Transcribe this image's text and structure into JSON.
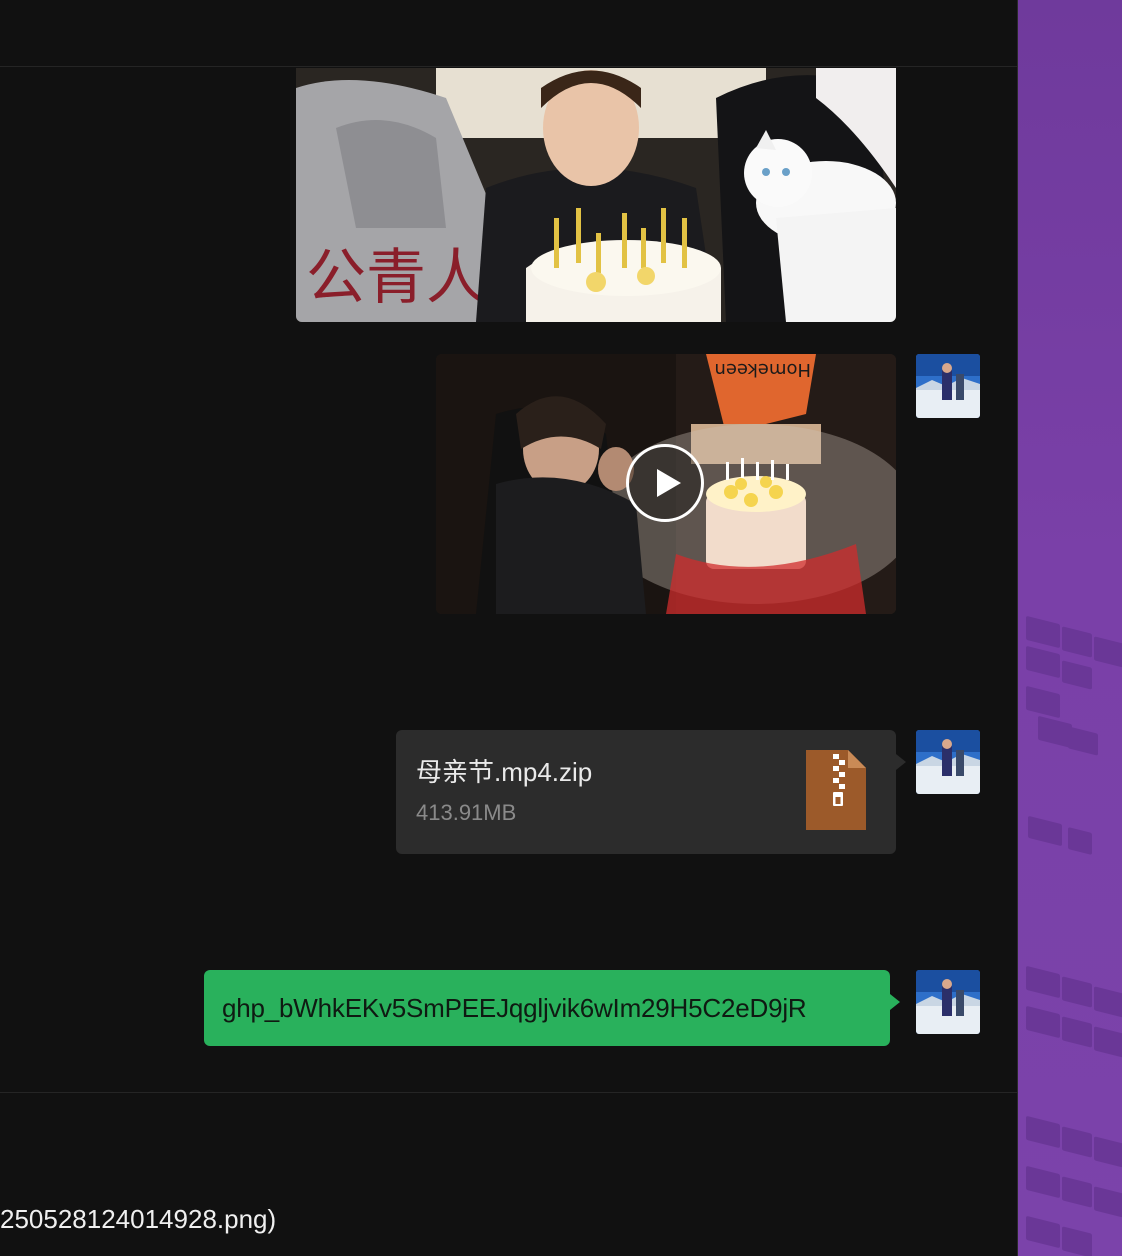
{
  "messages": {
    "file": {
      "name": "母亲节.mp4.zip",
      "size": "413.91MB",
      "icon": "zip-archive-icon"
    },
    "text": {
      "content": "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"
    },
    "video": {
      "icon": "play-icon"
    }
  },
  "input": {
    "draft_text": "250528124014928.png)"
  },
  "colors": {
    "background": "#111111",
    "outgoing_bubble": "#29b15c",
    "file_card": "#2c2c2c",
    "desktop": "#7a40a8"
  }
}
